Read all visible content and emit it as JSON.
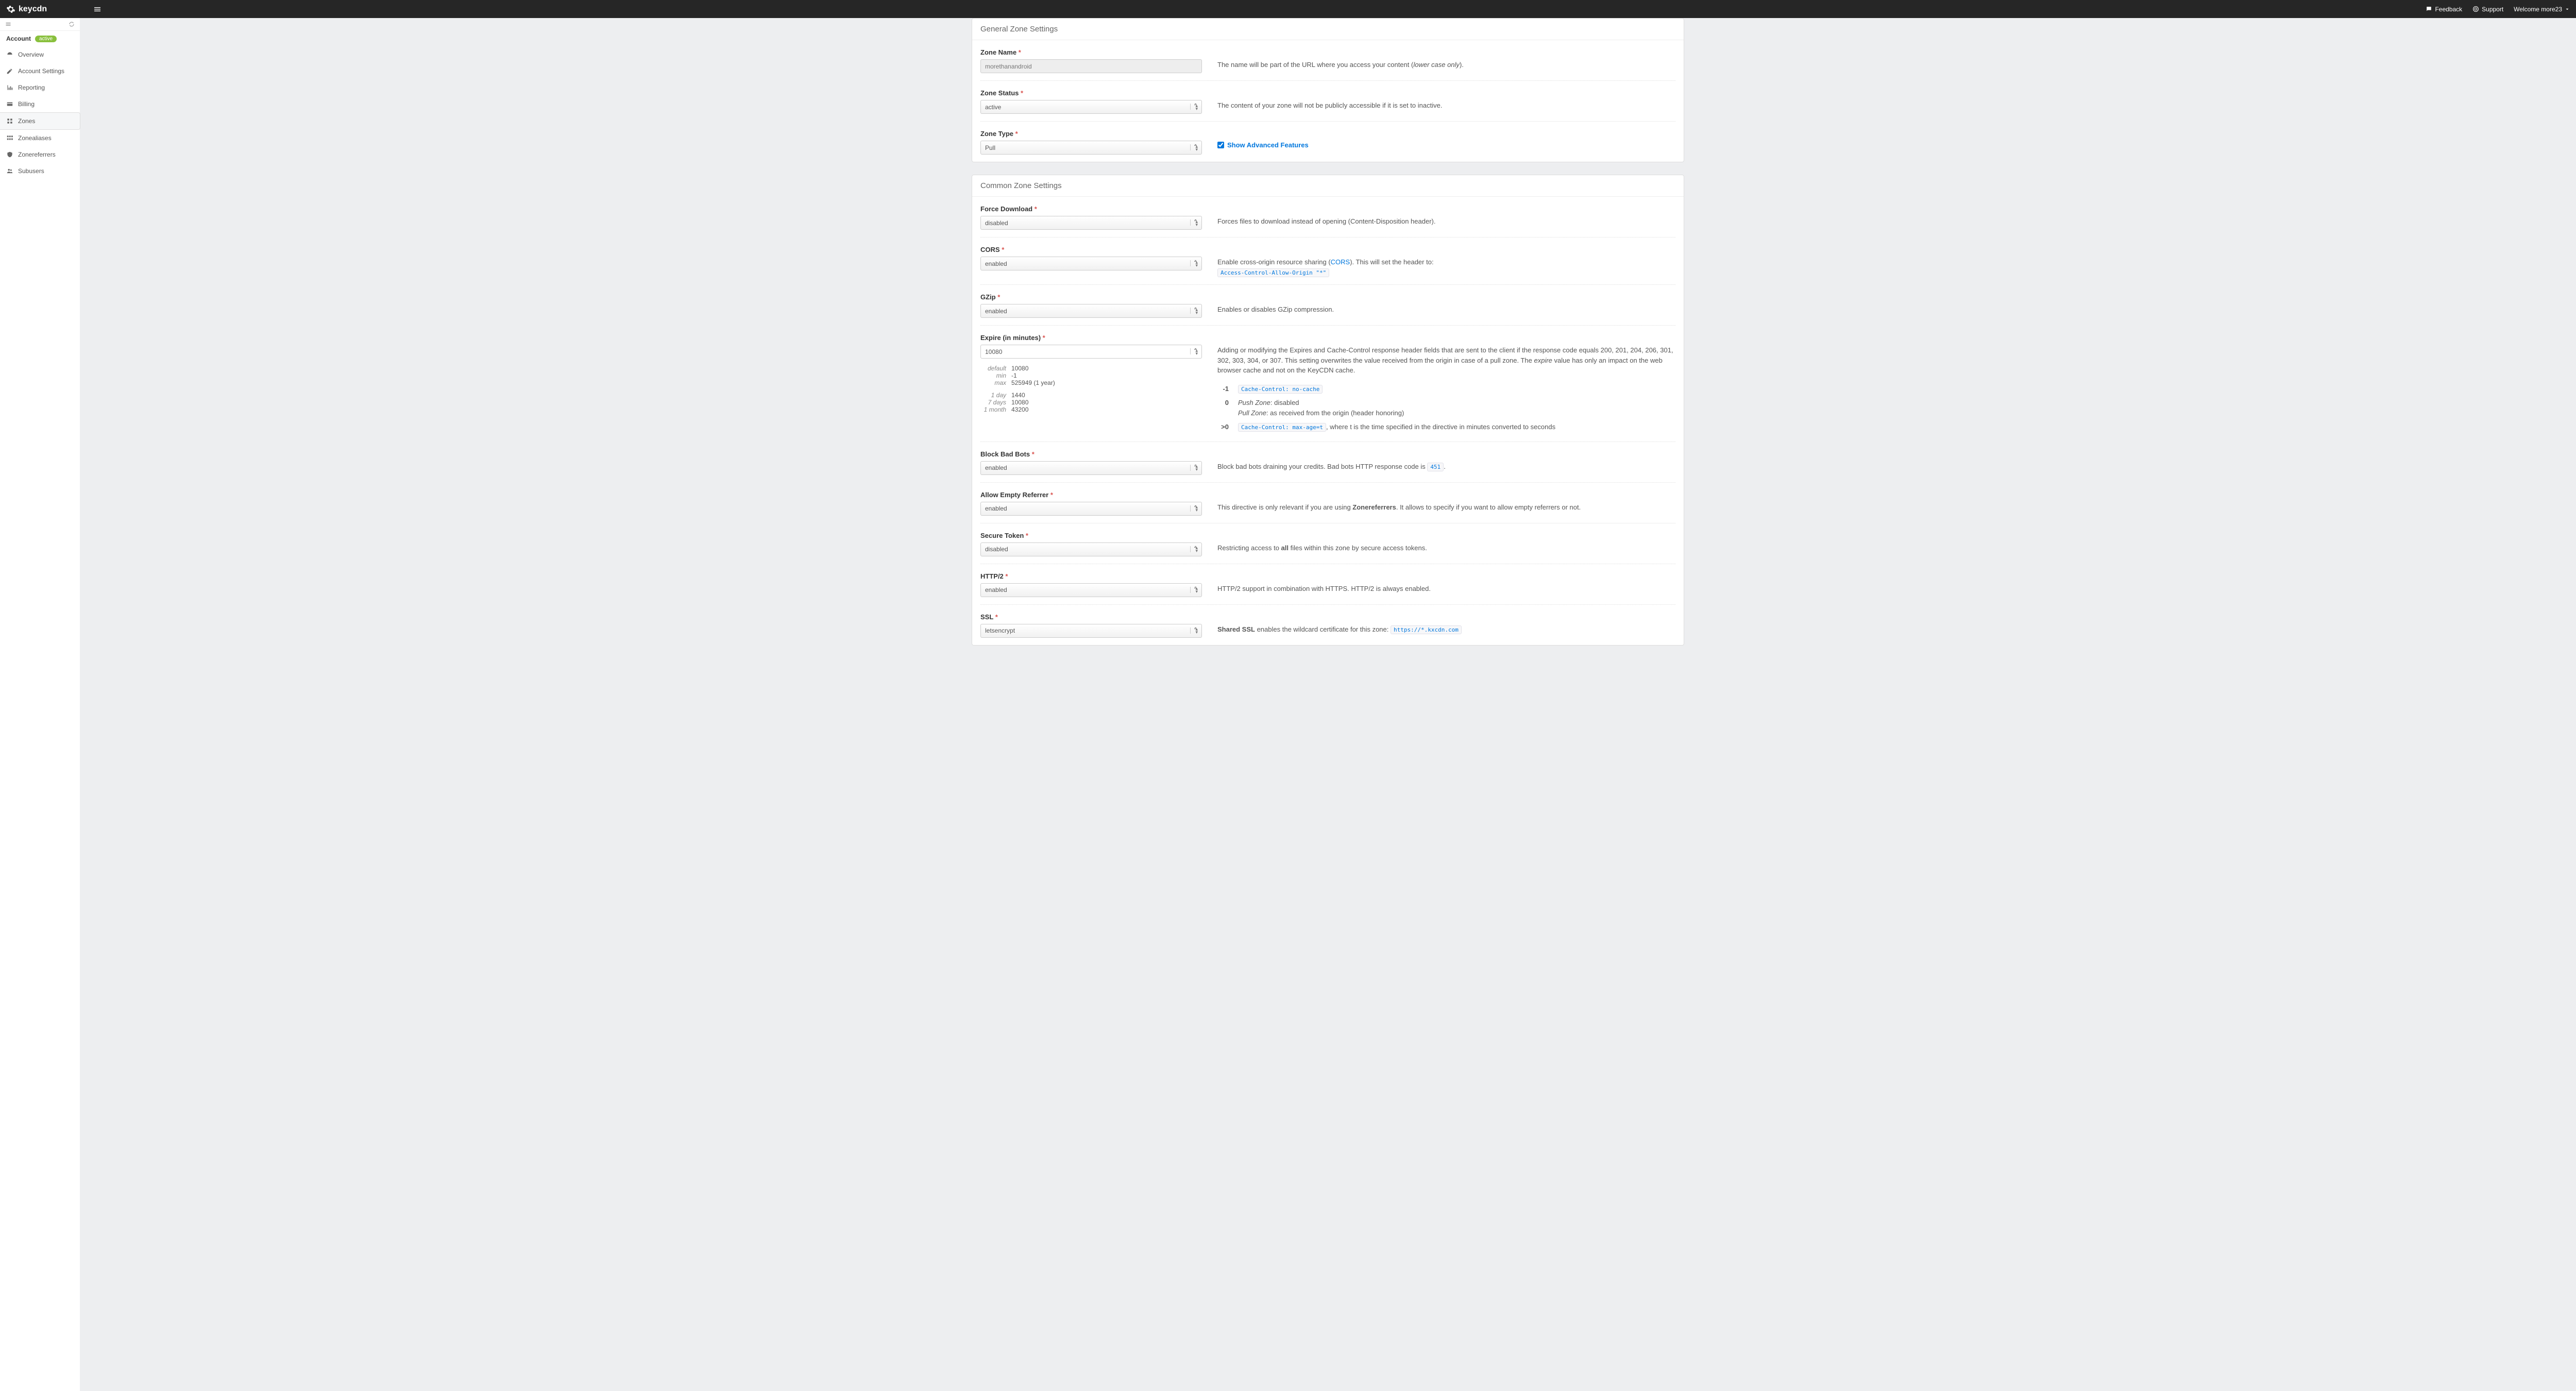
{
  "topbar": {
    "brand": "keycdn",
    "feedback": "Feedback",
    "support": "Support",
    "welcome": "Welcome more23"
  },
  "sidebar": {
    "account_label": "Account",
    "account_badge": "active",
    "items": [
      {
        "label": "Overview"
      },
      {
        "label": "Account Settings"
      },
      {
        "label": "Reporting"
      },
      {
        "label": "Billing"
      },
      {
        "label": "Zones"
      },
      {
        "label": "Zonealiases"
      },
      {
        "label": "Zonereferrers"
      },
      {
        "label": "Subusers"
      }
    ]
  },
  "general": {
    "heading": "General Zone Settings",
    "zone_name": {
      "label": "Zone Name",
      "value": "morethanandroid",
      "help_pre": "The name will be part of the URL where you access your content (",
      "help_em": "lower case only",
      "help_post": ")."
    },
    "zone_status": {
      "label": "Zone Status",
      "value": "active",
      "help": "The content of your zone will not be publicly accessible if it is set to inactive."
    },
    "zone_type": {
      "label": "Zone Type",
      "value": "Pull",
      "show_adv": "Show Advanced Features"
    }
  },
  "common": {
    "heading": "Common Zone Settings",
    "force_download": {
      "label": "Force Download",
      "value": "disabled",
      "help": "Forces files to download instead of opening (Content-Disposition header)."
    },
    "cors": {
      "label": "CORS",
      "value": "enabled",
      "help_pre": "Enable cross-origin resource sharing (",
      "help_link": "CORS",
      "help_post": "). This will set the header to:",
      "code": "Access-Control-Allow-Origin \"*\""
    },
    "gzip": {
      "label": "GZip",
      "value": "enabled",
      "help": "Enables or disables GZip compression."
    },
    "expire": {
      "label": "Expire (in minutes)",
      "value": "10080",
      "meta": [
        {
          "k": "default",
          "v": "10080"
        },
        {
          "k": "min",
          "v": "-1"
        },
        {
          "k": "max",
          "v": "525949 (1 year)"
        }
      ],
      "meta2": [
        {
          "k": "1 day",
          "v": "1440"
        },
        {
          "k": "7 days",
          "v": "10080"
        },
        {
          "k": "1 month",
          "v": "43200"
        }
      ],
      "help_p1a": "Adding or modifying the Expires and Cache-Control response header fields that are sent to the client if the response code equals 200, 201, 204, 206, 301, 302, 303, 304, or 307. This setting overwrites the value received from the origin in case of a pull zone. The ",
      "help_p1_em": "expire",
      "help_p1b": " value has only an impact on the web browser cache and not on the KeyCDN cache.",
      "rows": [
        {
          "k": "-1",
          "code": "Cache-Control: no-cache"
        },
        {
          "k": "0",
          "push_lbl": "Push Zone",
          "push_txt": ": disabled",
          "pull_lbl": "Pull Zone",
          "pull_txt": ": as received from the origin (header honoring)"
        },
        {
          "k": ">0",
          "code": "Cache-Control: max-age=t",
          "tail": ", where t is the time specified in the directive in minutes converted to seconds"
        }
      ]
    },
    "block_bad_bots": {
      "label": "Block Bad Bots",
      "value": "enabled",
      "help_pre": "Block bad bots draining your credits. Bad bots HTTP response code is ",
      "code": "451",
      "help_post": "."
    },
    "allow_empty_ref": {
      "label": "Allow Empty Referrer",
      "value": "enabled",
      "help_pre": "This directive is only relevant if you are using ",
      "help_bold": "Zonereferrers",
      "help_post": ". It allows to specify if you want to allow empty referrers or not."
    },
    "secure_token": {
      "label": "Secure Token",
      "value": "disabled",
      "help_pre": "Restricting access to ",
      "help_bold": "all",
      "help_post": " files within this zone by secure access tokens."
    },
    "http2": {
      "label": "HTTP/2",
      "value": "enabled",
      "help": "HTTP/2 support in combination with HTTPS. HTTP/2 is always enabled."
    },
    "ssl": {
      "label": "SSL",
      "value": "letsencrypt",
      "help_bold": "Shared SSL",
      "help_txt": " enables the wildcard certificate for this zone: ",
      "code": "https://*.kxcdn.com"
    }
  }
}
